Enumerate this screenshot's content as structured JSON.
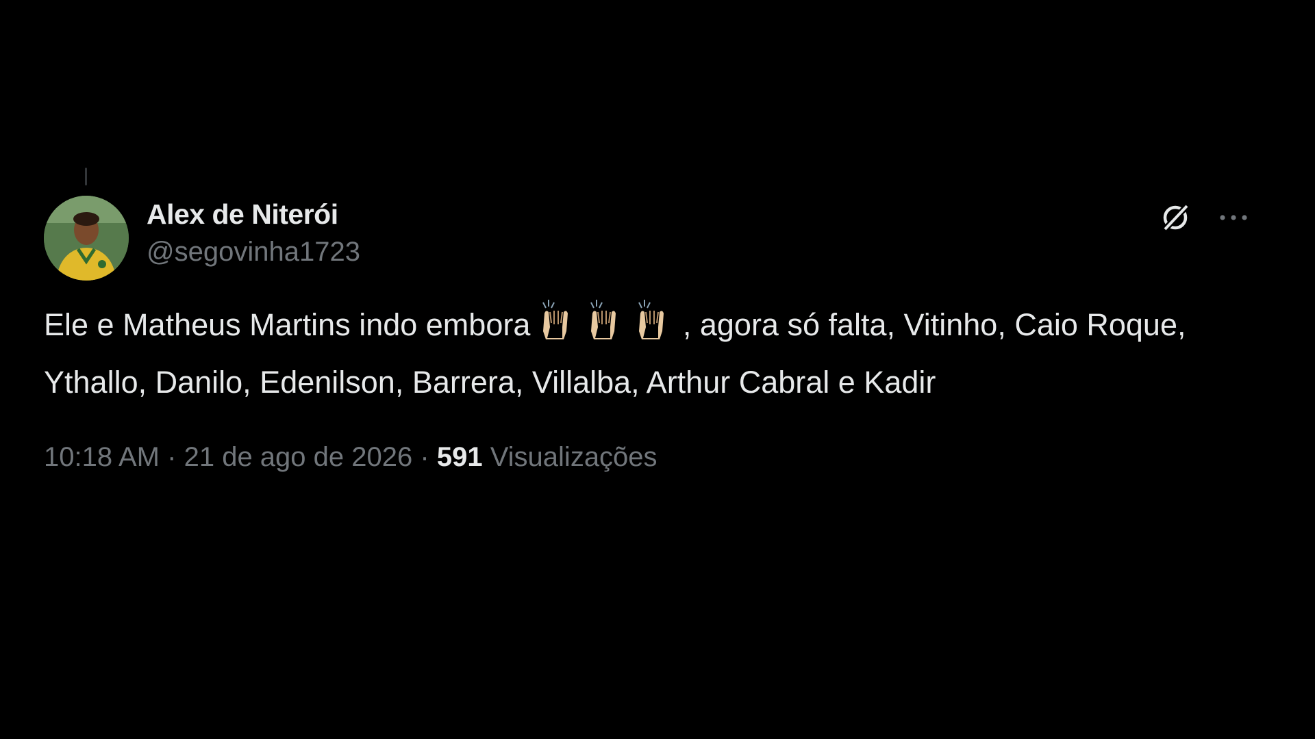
{
  "tweet": {
    "author": {
      "display_name": "Alex de Niterói",
      "handle": "@segovinha1723",
      "avatar_icon": "profile-photo-avatar"
    },
    "header_actions": {
      "grok_icon": "grok-icon",
      "more_icon": "more-options-icon"
    },
    "text_before_emoji": "Ele e Matheus Martins indo embora ",
    "emoji": "🙌🏼🙌🏼🙌🏼",
    "emoji_icon": "raising-hands-emoji",
    "text_after_emoji": ", agora só falta, Vitinho, Caio Roque, Ythallo, Danilo, Edenilson, Barrera, Villalba, Arthur Cabral e Kadir",
    "time": "10:18 AM",
    "separator": "·",
    "date": "21 de ago de 2026",
    "views_count": "591",
    "views_label": "Visualizações"
  },
  "colors": {
    "background": "#000000",
    "primary_text": "#e7e9ea",
    "secondary_text": "#71767b"
  }
}
